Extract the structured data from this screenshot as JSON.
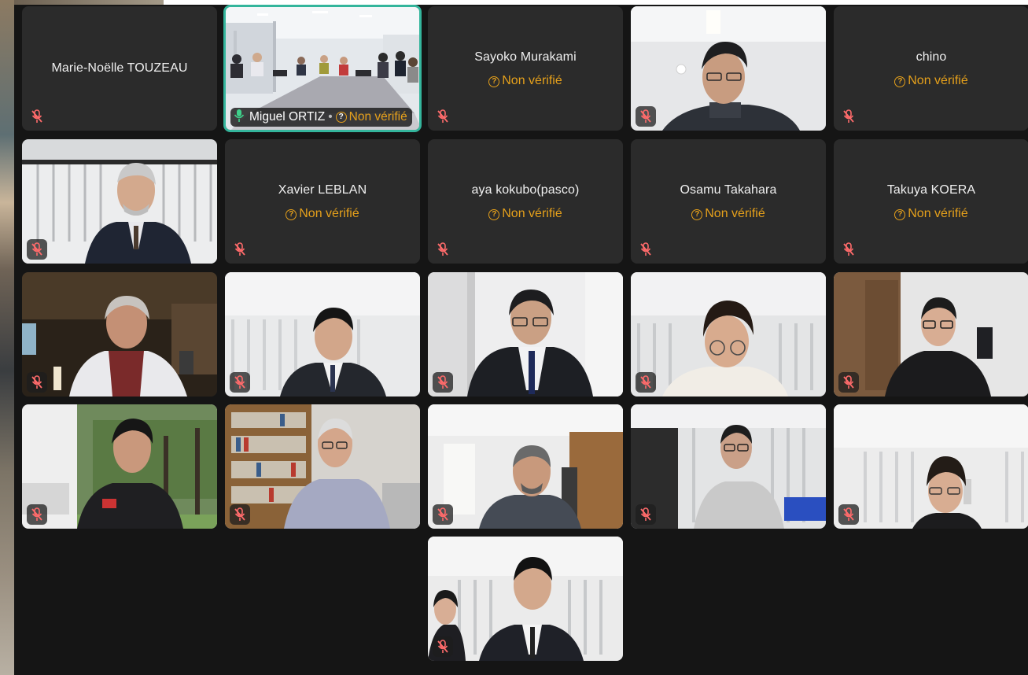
{
  "participants": [
    {
      "name": "Marie-Noëlle TOUZEAU",
      "status": "",
      "video": false
    },
    {
      "name": "Miguel ORTIZ",
      "status": "Non vérifié",
      "video": true,
      "speaking": true
    },
    {
      "name": "Sayoko Murakami",
      "status": "Non vérifié",
      "video": false
    },
    {
      "name": "",
      "status": "",
      "video": true
    },
    {
      "name": "chino",
      "status": "Non vérifié",
      "video": false
    },
    {
      "name": "",
      "status": "",
      "video": true
    },
    {
      "name": "Xavier LEBLAN",
      "status": "Non vérifié",
      "video": false
    },
    {
      "name": "aya kokubo(pasco)",
      "status": "Non vérifié",
      "video": false
    },
    {
      "name": "Osamu Takahara",
      "status": "Non vérifié",
      "video": false
    },
    {
      "name": "Takuya KOERA",
      "status": "Non vérifié",
      "video": false
    }
  ],
  "icons": {
    "muted": "mic-muted-icon",
    "speaking": "mic-active-icon",
    "unverified": "question-circle-icon"
  },
  "colors": {
    "accent_active_border": "#34b59c",
    "status_warning": "#e5a01b",
    "tile_bg": "#2b2b2b",
    "muted_icon": "#ff6b6b"
  }
}
